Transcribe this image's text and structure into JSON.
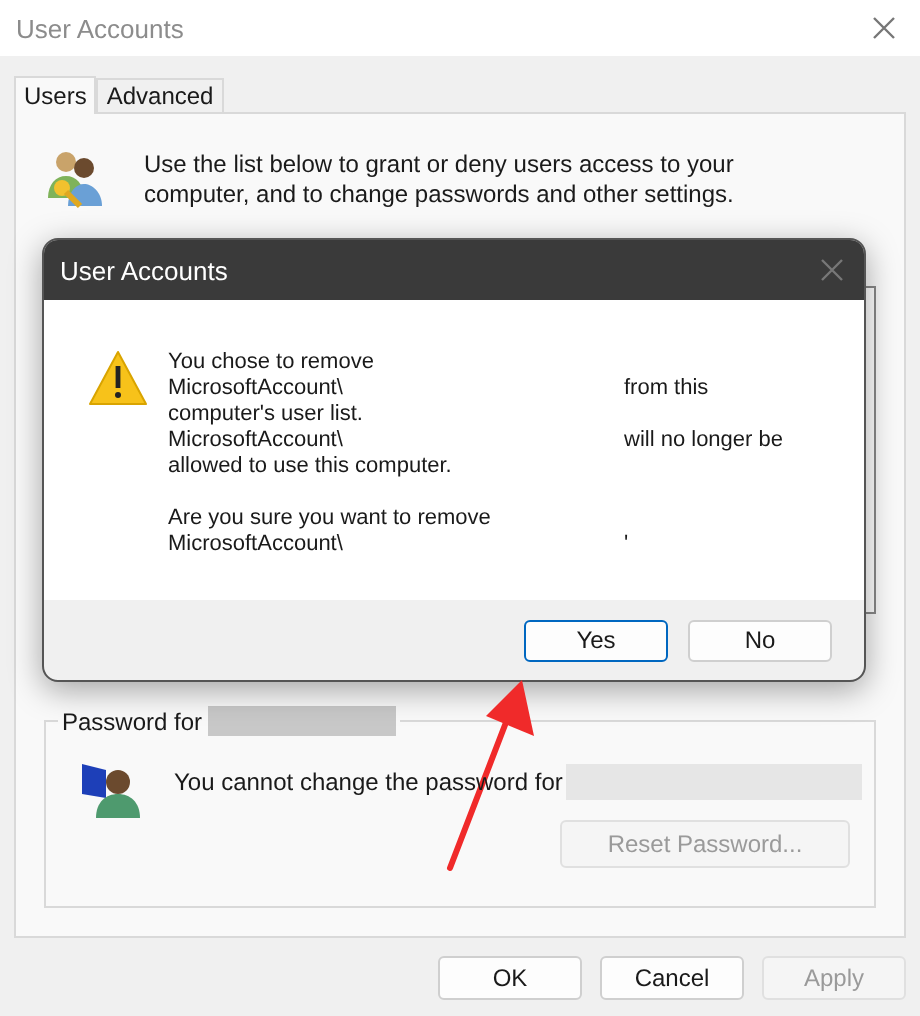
{
  "window": {
    "title": "User Accounts"
  },
  "tabs": [
    {
      "label": "Users",
      "selected": true
    },
    {
      "label": "Advanced",
      "selected": false
    }
  ],
  "intro": "Use the list below to grant or deny users access to your computer, and to change passwords and other settings.",
  "password_group": {
    "legend": "Password for",
    "message": "You cannot change the password for",
    "reset_button": {
      "label": "Reset Password...",
      "disabled": true
    }
  },
  "buttons": [
    {
      "label": "OK",
      "disabled": false
    },
    {
      "label": "Cancel",
      "disabled": false
    },
    {
      "label": "Apply",
      "disabled": true
    }
  ],
  "dialog": {
    "title": "User Accounts",
    "paragraphs": [
      [
        {
          "text": "You chose to remove"
        },
        {
          "text": "MicrosoftAccount\\",
          "tail": "from this"
        },
        {
          "text": "computer's user list."
        },
        {
          "text": "MicrosoftAccount\\",
          "tail": "will no longer be"
        },
        {
          "text": "allowed to use this computer."
        }
      ],
      [
        {
          "text": "Are you sure you want to remove"
        },
        {
          "text": "MicrosoftAccount\\",
          "tail": "'"
        }
      ]
    ],
    "buttons": [
      {
        "label": "Yes",
        "selected": true
      },
      {
        "label": "No",
        "selected": false
      }
    ]
  }
}
